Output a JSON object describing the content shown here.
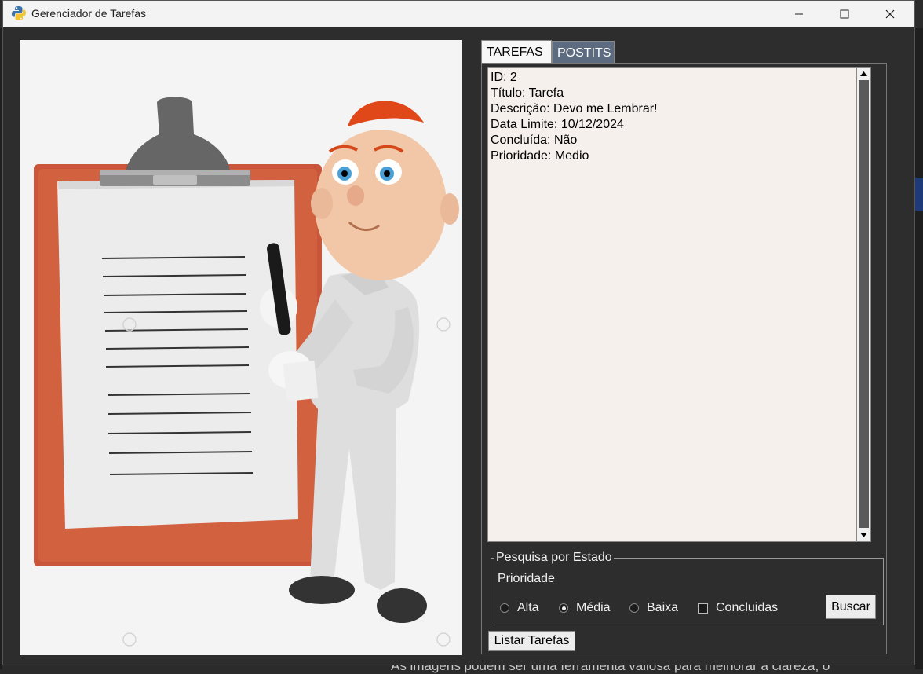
{
  "window": {
    "title": "Gerenciador de Tarefas"
  },
  "tabs": [
    {
      "label": "TAREFAS",
      "active": true
    },
    {
      "label": "POSTITS",
      "active": false
    }
  ],
  "task_details": {
    "lines": [
      "ID: 2",
      "Título: Tarefa",
      "Descrição: Devo me Lembrar!",
      "Data Limite: 10/12/2024",
      "Concluída: Não",
      "Prioridade: Medio"
    ]
  },
  "search": {
    "group_title": "Pesquisa por Estado",
    "priority_label": "Prioridade",
    "options": [
      {
        "label": "Alta",
        "selected": false
      },
      {
        "label": "Média",
        "selected": true
      },
      {
        "label": "Baixa",
        "selected": false
      }
    ],
    "completed_label": "Concluidas",
    "completed_checked": false,
    "search_button": "Buscar"
  },
  "list_button": "Listar Tarefas",
  "background": {
    "bottom_text": "As imagens podem ser uma ferramenta valiosa para melhorar a clareza, o"
  },
  "colors": {
    "window_bg": "#2d2d2d",
    "text_area_bg": "#f5f0eb",
    "active_tab": "#f7f7f7",
    "inactive_tab": "#5c6b80"
  }
}
